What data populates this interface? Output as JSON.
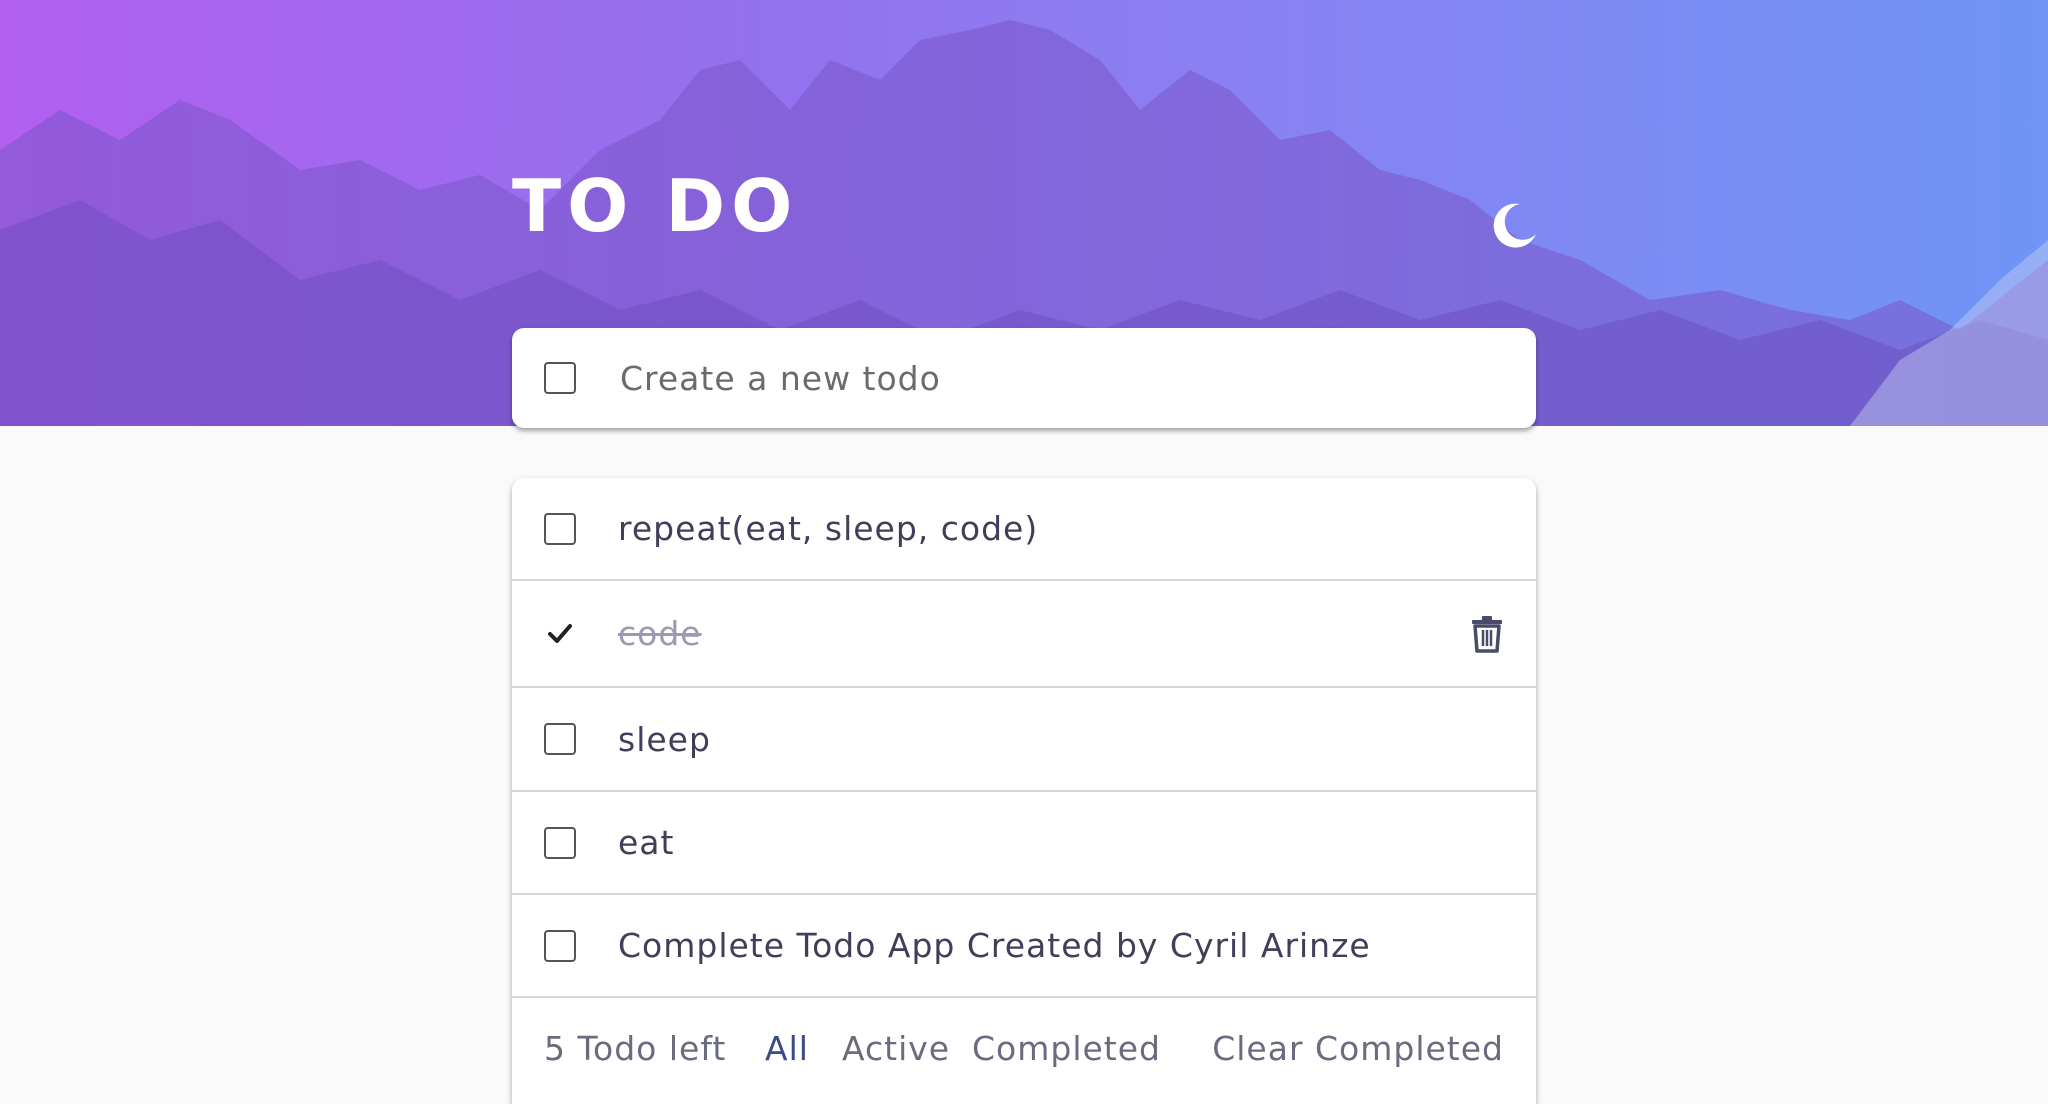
{
  "header": {
    "title": "TO DO",
    "theme_toggle_icon": "moon-icon"
  },
  "new_todo": {
    "placeholder": "Create a new todo",
    "value": ""
  },
  "todos": [
    {
      "text": "repeat(eat, sleep, code)",
      "completed": false
    },
    {
      "text": "code",
      "completed": true
    },
    {
      "text": "sleep",
      "completed": false
    },
    {
      "text": "eat",
      "completed": false
    },
    {
      "text": "Complete Todo App Created by Cyril Arinze",
      "completed": false
    }
  ],
  "footer": {
    "items_left": "5 Todo left",
    "filter_all": "All",
    "filter_active": "Active",
    "filter_completed": "Completed",
    "clear_completed": "Clear Completed",
    "active_filter": "All"
  },
  "colors": {
    "gradient_start": "#b25ff0",
    "gradient_end": "#6f95f6",
    "text": "#3f3f5a",
    "completed_text": "#9a9ab0",
    "active_filter": "#3a4a8a"
  }
}
